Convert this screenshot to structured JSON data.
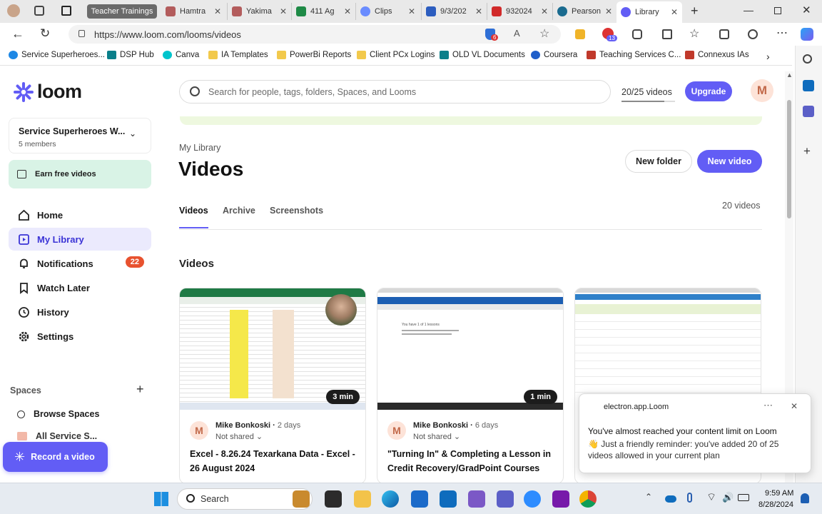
{
  "browser": {
    "tabs": [
      {
        "label": "Teacher Trainings",
        "color": "#5b5b5b"
      },
      {
        "label": "Hamtra",
        "color": "#b35c5c"
      },
      {
        "label": "Yakima",
        "color": "#b35c5c"
      },
      {
        "label": "411 Ag",
        "color": "#1e8a46"
      },
      {
        "label": "Clips",
        "color": "#6a8cff"
      },
      {
        "label": "9/3/202",
        "color": "#2c5dbf"
      },
      {
        "label": "932024",
        "color": "#d12a2a"
      },
      {
        "label": "Pearson",
        "color": "#1a6b8f"
      },
      {
        "label": "Library",
        "color": "#625df5"
      }
    ],
    "url": "https://www.loom.com/looms/videos",
    "badges": {
      "shield": "6",
      "ext": "13"
    },
    "bookmarks": [
      {
        "label": "Service Superheroes...",
        "color": "#1e88e5"
      },
      {
        "label": "DSP Hub",
        "color": "#0a7f8a"
      },
      {
        "label": "Canva",
        "color": "#00c4cc"
      },
      {
        "label": "IA Templates",
        "color": "#f2c94c"
      },
      {
        "label": "PowerBi Reports",
        "color": "#f2c94c"
      },
      {
        "label": "Client PCx Logins",
        "color": "#f2c94c"
      },
      {
        "label": "OLD VL Documents",
        "color": "#0a7f8a"
      },
      {
        "label": "Coursera",
        "color": "#1f5ec9"
      },
      {
        "label": "Teaching Services C...",
        "color": "#c0392b"
      },
      {
        "label": "Connexus IAs",
        "color": "#c0392b"
      }
    ]
  },
  "loom": {
    "logo_text": "loom",
    "workspace": {
      "name": "Service Superheroes W...",
      "members": "5 members"
    },
    "earn_label": "Earn free videos",
    "nav": [
      {
        "label": "Home",
        "icon": "home-icon"
      },
      {
        "label": "My Library",
        "icon": "library-icon"
      },
      {
        "label": "Notifications",
        "icon": "bell-icon",
        "badge": "22"
      },
      {
        "label": "Watch Later",
        "icon": "bookmark-icon"
      },
      {
        "label": "History",
        "icon": "clock-icon"
      },
      {
        "label": "Settings",
        "icon": "gear-icon"
      }
    ],
    "spaces_label": "Spaces",
    "browse_spaces": "Browse Spaces",
    "partial_item": "All Service S...",
    "record_label": "Record a video",
    "search_placeholder": "Search for people, tags, folders, Spaces, and Looms",
    "quota": "20/25 videos",
    "upgrade": "Upgrade",
    "avatar_letter": "M",
    "breadcrumb": "My Library",
    "page_title": "Videos",
    "new_folder": "New folder",
    "new_video": "New video",
    "tabs": [
      "Videos",
      "Archive",
      "Screenshots"
    ],
    "video_count": "20 videos",
    "section_title": "Videos",
    "cards": [
      {
        "duration": "3 min",
        "author": "Mike Bonkoski",
        "when": "2 days",
        "shared": "Not shared",
        "title": "Excel - 8.26.24 Texarkana Data - Excel - 26 August 2024"
      },
      {
        "duration": "1 min",
        "author": "Mike Bonkoski",
        "when": "6 days",
        "shared": "Not shared",
        "title": "\"Turning In\" & Completing a Lesson in Credit Recovery/GradPoint Courses"
      },
      {
        "duration": "",
        "author": "",
        "when": "",
        "shared": "",
        "title": ""
      }
    ],
    "thumb_text": "You have 1 of 1 lessons"
  },
  "toast": {
    "app": "electron.app.Loom",
    "title": "You've almost reached your content limit on Loom",
    "body": "👋 Just a friendly reminder: you've added 20 of 25 videos allowed in your current plan"
  },
  "taskbar": {
    "search": "Search",
    "time": "9:59 AM",
    "date": "8/28/2024"
  },
  "colors": {
    "brand": "#625df5",
    "active_nav": "#ebeafd",
    "earn_bg": "#d9f3e6"
  }
}
